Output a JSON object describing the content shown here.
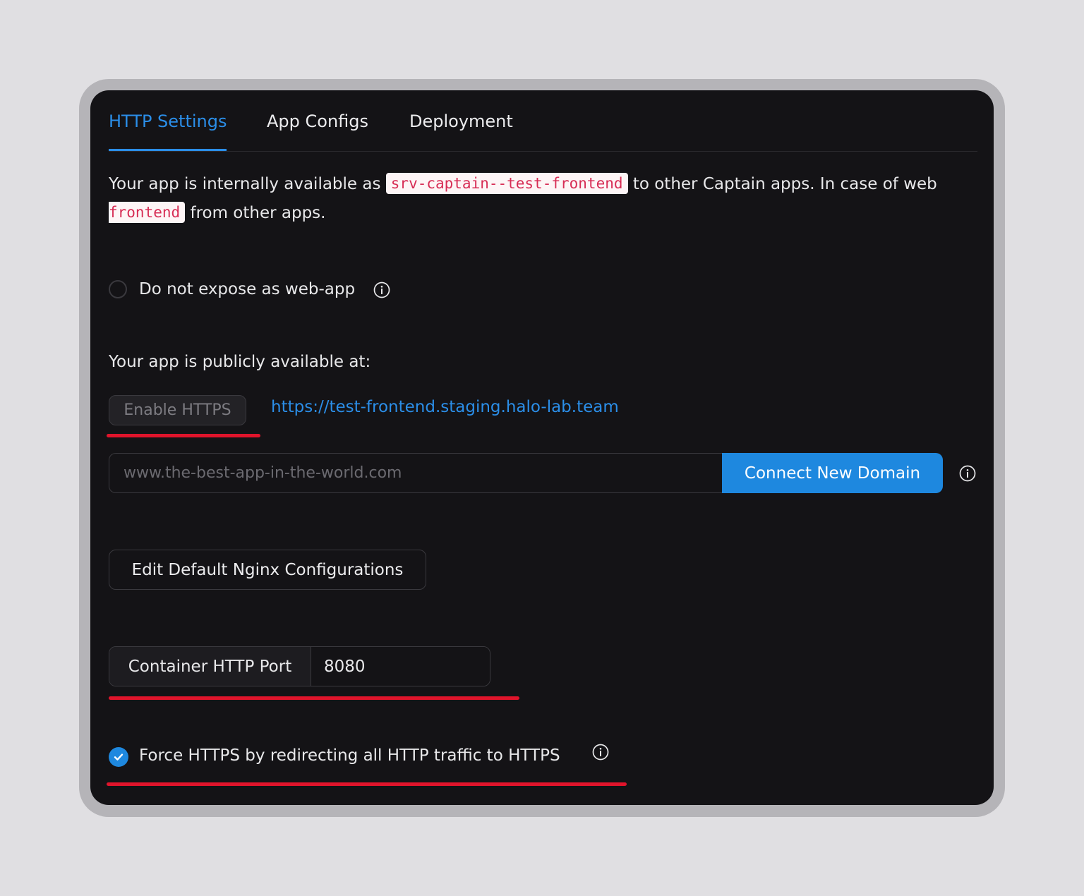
{
  "tabs": [
    {
      "label": "HTTP Settings",
      "active": true
    },
    {
      "label": "App Configs",
      "active": false
    },
    {
      "label": "Deployment",
      "active": false
    }
  ],
  "intro": {
    "text_before_internal": "Your app is internally available as",
    "internal_name": "srv-captain--test-frontend",
    "text_after_internal": "to other Captain apps. In case of web",
    "code_frontend": "frontend",
    "text_end": "from other apps."
  },
  "expose": {
    "label": "Do not expose as web-app",
    "checked": false,
    "info_icon": "info-circle-icon"
  },
  "public": {
    "label": "Your app is publicly available at:",
    "enable_https_label": "Enable HTTPS",
    "url": "https://test-frontend.staging.halo-lab.team"
  },
  "domain": {
    "placeholder": "www.the-best-app-in-the-world.com",
    "value": "",
    "connect_label": "Connect New Domain",
    "info_icon": "info-circle-icon"
  },
  "nginx": {
    "edit_label": "Edit Default Nginx Configurations"
  },
  "port": {
    "label": "Container HTTP Port",
    "value": "8080"
  },
  "force_https": {
    "label": "Force HTTPS by redirecting all HTTP traffic to HTTPS",
    "checked": true,
    "info_icon": "info-circle-icon"
  },
  "colors": {
    "accent": "#1e88df",
    "link": "#2b8ee8",
    "panel_bg": "#141316",
    "annotation_red": "#e0142b",
    "code_text": "#d72d55"
  }
}
